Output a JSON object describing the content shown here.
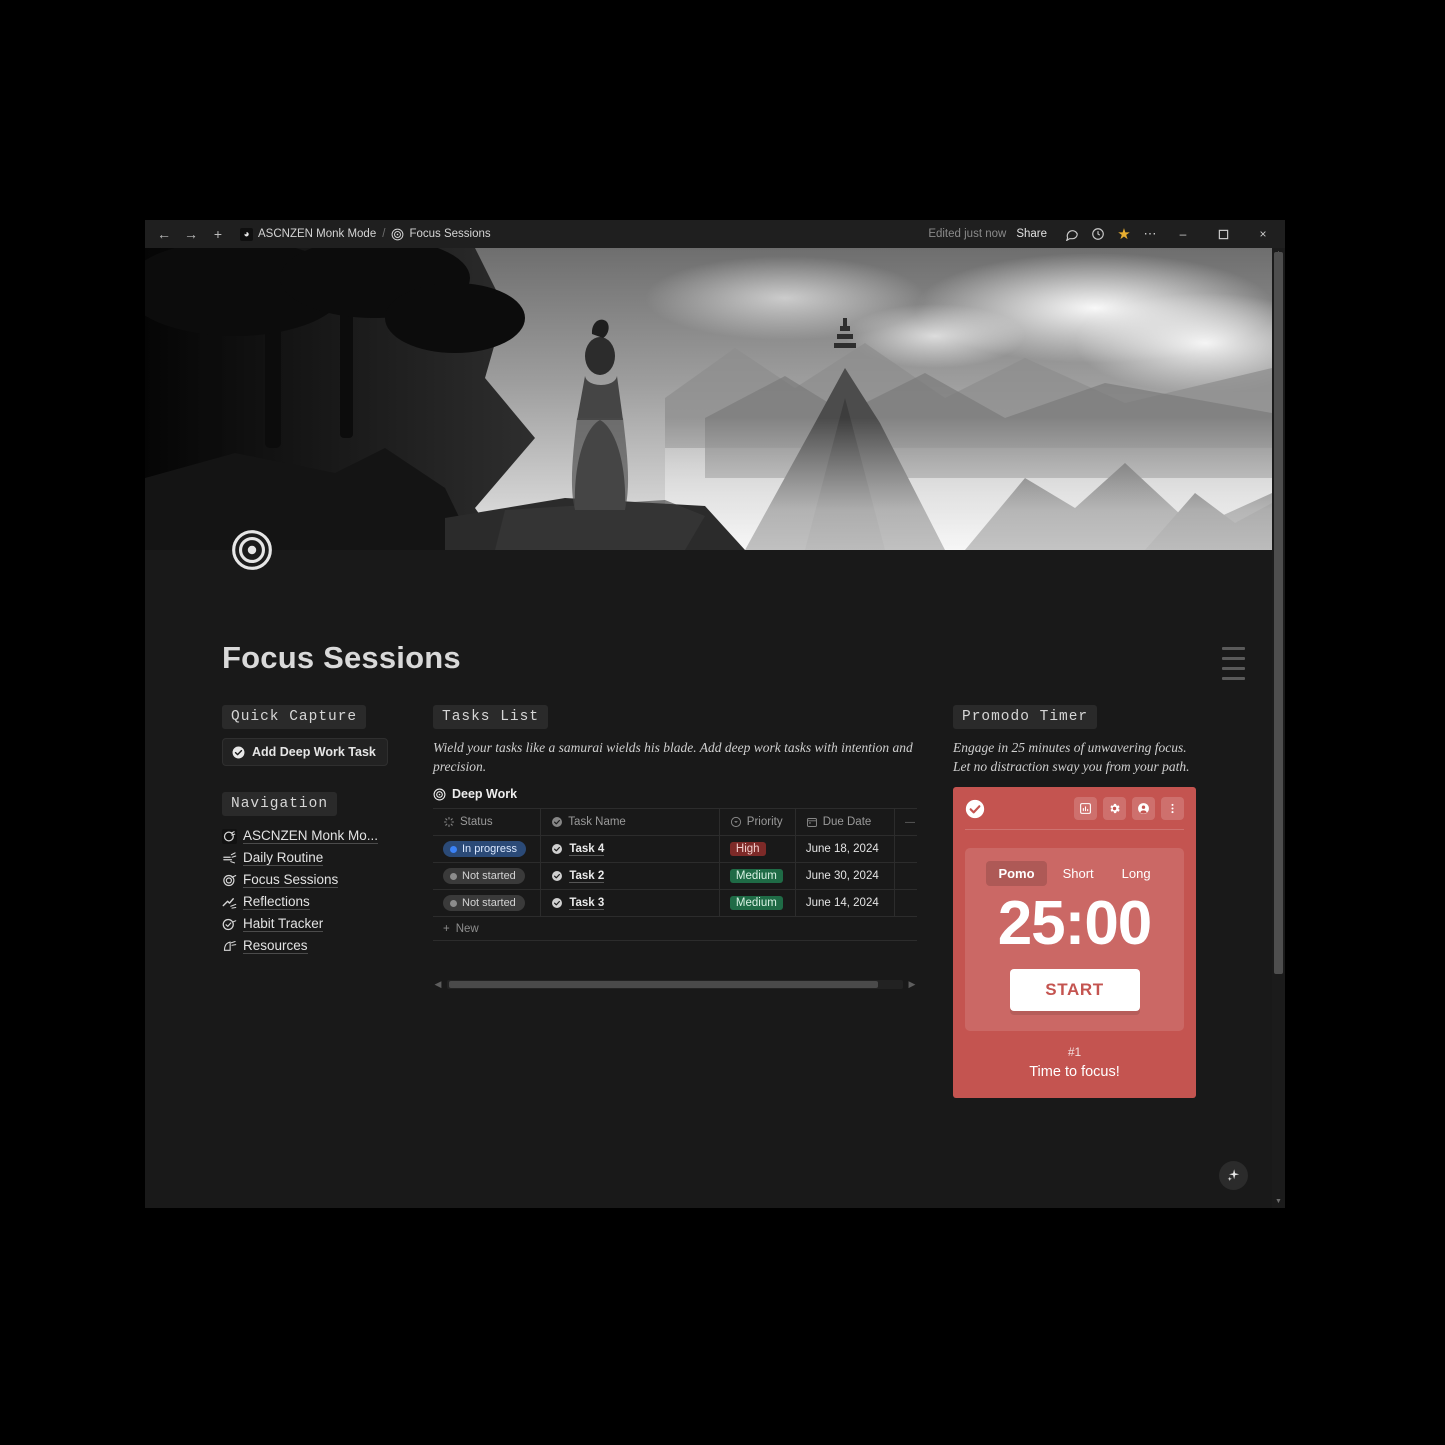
{
  "titlebar": {
    "back_icon": "arrow-left-icon",
    "forward_icon": "arrow-right-icon",
    "new_icon": "plus-icon",
    "workspace": "ASCNZEN Monk Mode",
    "separator": "/",
    "page": "Focus Sessions",
    "edited": "Edited just now",
    "share": "Share",
    "comment_icon": "comment-icon",
    "history_icon": "clock-icon",
    "favorite_icon": "star-icon",
    "more_icon": "ellipsis-icon",
    "minimize": "–",
    "maximize": "☐",
    "close": "×"
  },
  "page": {
    "icon": "target-icon",
    "title": "Focus Sessions",
    "toc_icon": "table-of-contents-icon"
  },
  "quick_capture": {
    "heading": "Quick Capture",
    "button_label": "Add Deep Work Task",
    "button_icon": "check-circle-icon"
  },
  "navigation": {
    "heading": "Navigation",
    "items": [
      {
        "label": "ASCNZEN Monk Mo...",
        "icon": "monk-page-icon"
      },
      {
        "label": "Daily Routine",
        "icon": "routine-page-icon"
      },
      {
        "label": "Focus Sessions",
        "icon": "target-page-icon"
      },
      {
        "label": "Reflections",
        "icon": "reflections-page-icon"
      },
      {
        "label": "Habit Tracker",
        "icon": "habit-page-icon"
      },
      {
        "label": "Resources",
        "icon": "resources-page-icon"
      }
    ]
  },
  "tasks": {
    "heading": "Tasks List",
    "description": "Wield your tasks like a samurai wields his blade. Add deep work tasks with intention and precision.",
    "database_name": "Deep Work",
    "database_icon": "target-icon",
    "columns": [
      {
        "label": "Status",
        "icon": "status-icon"
      },
      {
        "label": "Task Name",
        "icon": "check-circle-icon"
      },
      {
        "label": "Priority",
        "icon": "select-icon"
      },
      {
        "label": "Due Date",
        "icon": "calendar-icon"
      },
      {
        "label": "",
        "icon": ""
      }
    ],
    "rows": [
      {
        "status": "In progress",
        "status_type": "inprogress",
        "name": "Task 4",
        "priority": "High",
        "priority_type": "high",
        "due": "June 18, 2024"
      },
      {
        "status": "Not started",
        "status_type": "notstarted",
        "name": "Task 2",
        "priority": "Medium",
        "priority_type": "medium",
        "due": "June 30, 2024"
      },
      {
        "status": "Not started",
        "status_type": "notstarted",
        "name": "Task 3",
        "priority": "Medium",
        "priority_type": "medium",
        "due": "June 14, 2024"
      }
    ],
    "new_row_label": "New",
    "new_row_icon": "plus-icon"
  },
  "pomodoro": {
    "heading": "Promodo Timer",
    "description": "Engage in 25 minutes of unwavering focus. Let no distraction sway you from your path.",
    "logo_icon": "check-circle-icon",
    "toolbar_icons": [
      "chart-icon",
      "gear-icon",
      "account-icon",
      "kebab-menu-icon"
    ],
    "tabs": [
      {
        "label": "Pomo",
        "active": true
      },
      {
        "label": "Short",
        "active": false
      },
      {
        "label": "Long",
        "active": false
      }
    ],
    "time": "25:00",
    "start_label": "START",
    "counter": "#1",
    "message": "Time to focus!",
    "accent_color": "#c45450"
  },
  "assistant": {
    "icon": "sparkle-icon"
  },
  "scrollbars": {
    "horizontal_left_arrow": "◀",
    "horizontal_right_arrow": "▶",
    "vertical_up_arrow": "▲",
    "vertical_down_arrow": "▼"
  }
}
